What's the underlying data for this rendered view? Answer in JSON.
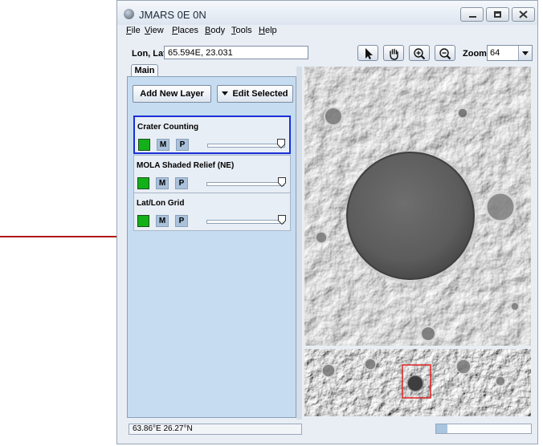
{
  "window": {
    "title": "JMARS 0E 0N"
  },
  "menu": [
    "File",
    "View",
    "Places",
    "Body",
    "Tools",
    "Help"
  ],
  "coords": {
    "label": "Lon, Lat",
    "value": "65.594E, 23.031"
  },
  "toolbar": {
    "tools": [
      "pointer-icon",
      "pan-hand-icon",
      "zoom-in-icon",
      "zoom-out-icon"
    ],
    "zoom_label": "Zoom:",
    "zoom_value": "64"
  },
  "tabs": [
    "Main"
  ],
  "buttons": {
    "add_layer": "Add New Layer",
    "edit_selected": "Edit Selected"
  },
  "layers": [
    {
      "name": "Crater Counting",
      "selected": true,
      "m": "M",
      "p": "P",
      "color": "#13b01a"
    },
    {
      "name": "MOLA Shaded Relief (NE)",
      "selected": false,
      "m": "M",
      "p": "P",
      "color": "#13b01a"
    },
    {
      "name": "Lat/Lon Grid",
      "selected": false,
      "m": "M",
      "p": "P",
      "color": "#13b01a"
    }
  ],
  "status": {
    "text": "63.86°E  26.27°N",
    "progress": 0.12
  },
  "colors": {
    "arrow": "#b01515",
    "selection": "#1a2fd6",
    "overview_box": "#e02020"
  }
}
